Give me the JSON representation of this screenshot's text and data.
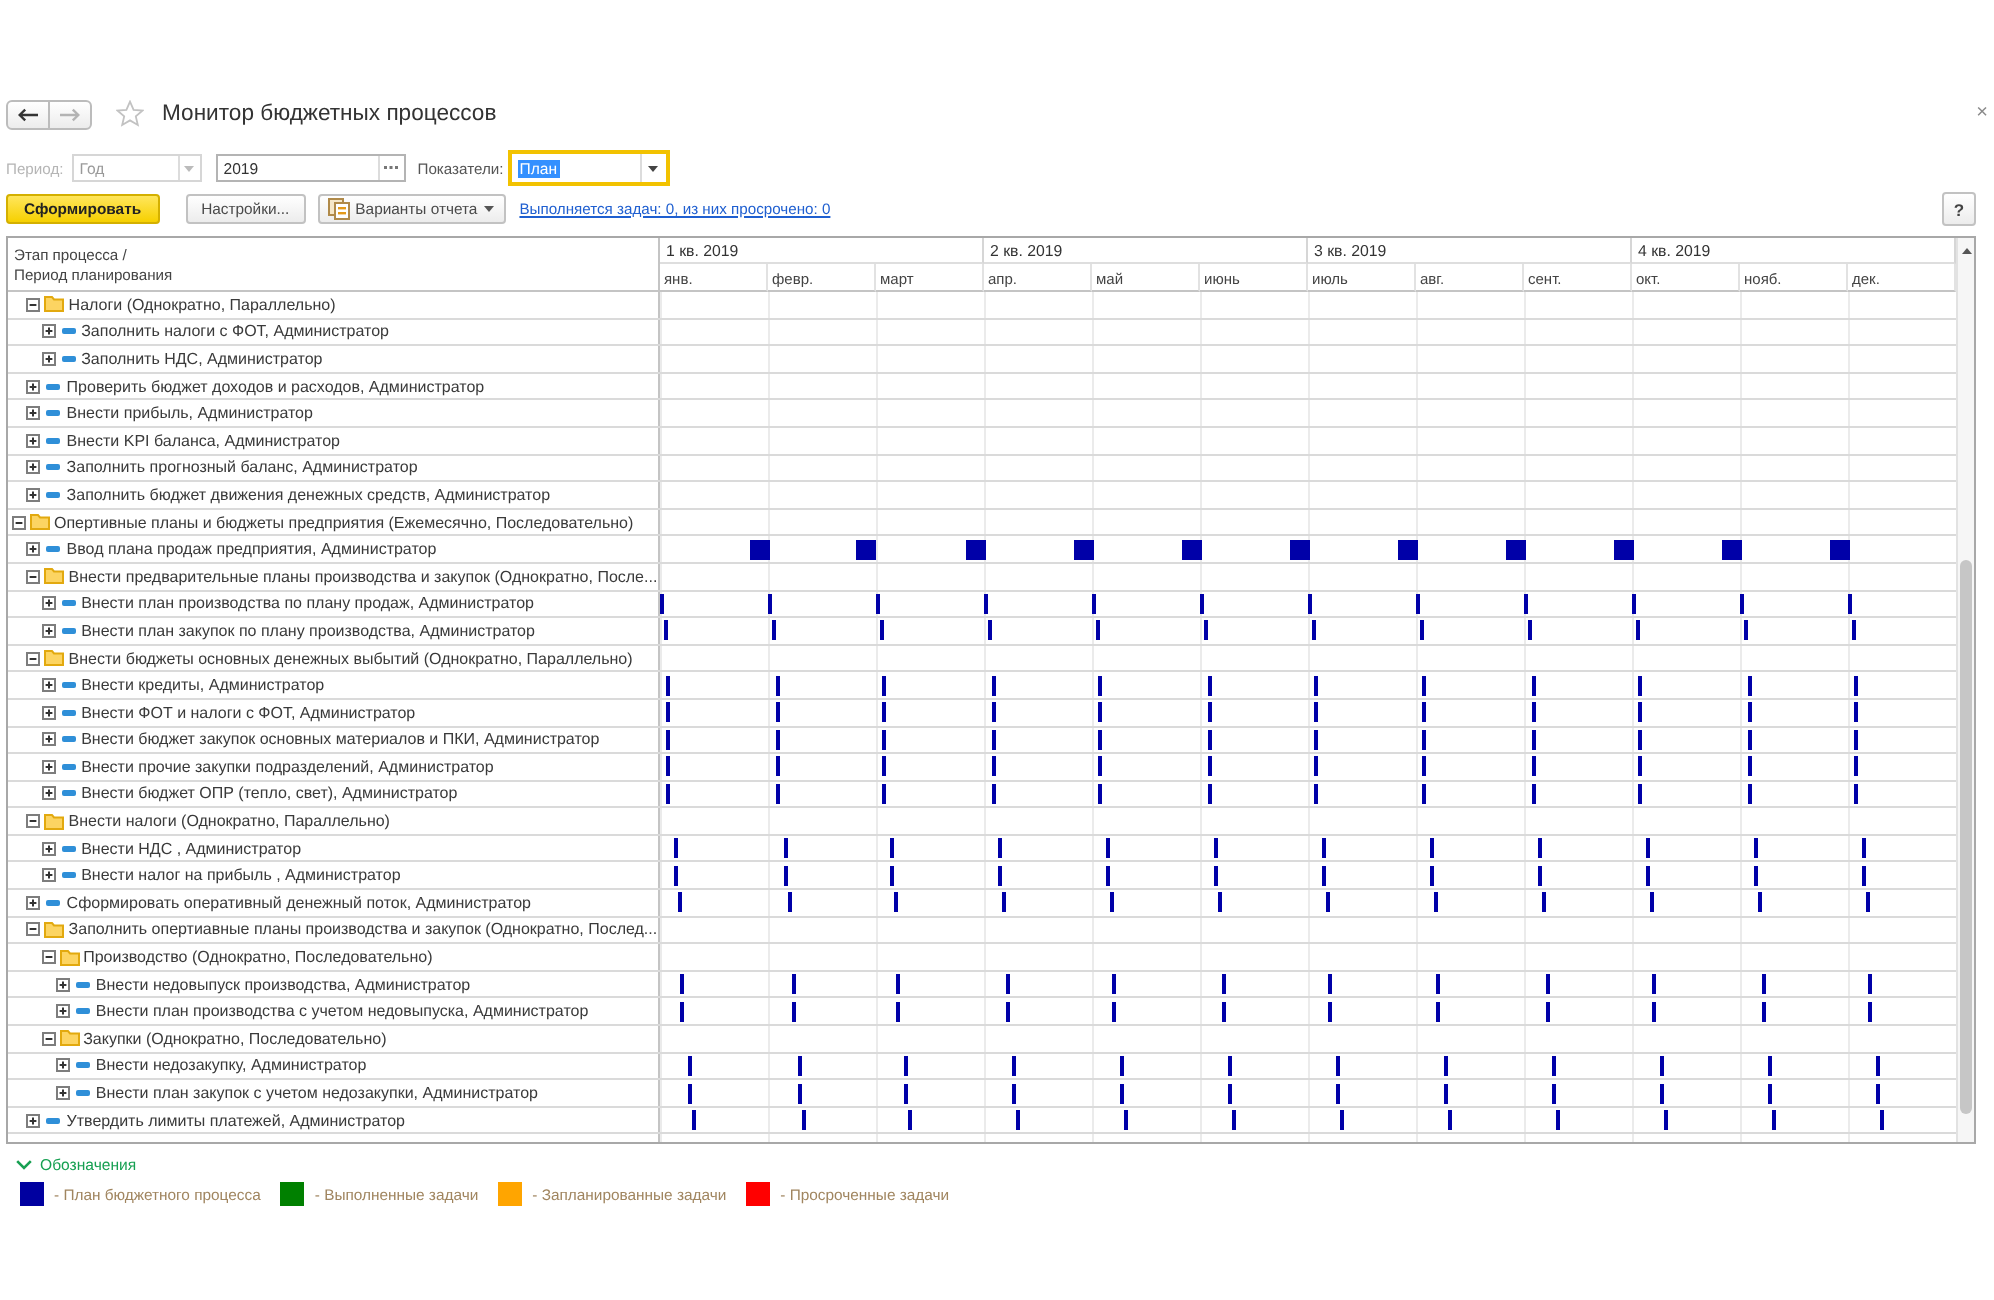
{
  "window": {
    "title": "Монитор бюджетных процессов",
    "favorite": false,
    "close": "×",
    "navigation": [
      {
        "kind": "back",
        "disabled": false
      },
      {
        "kind": "forward",
        "disabled": true
      }
    ]
  },
  "filters": {
    "period": {
      "label": "Период:",
      "value": "Год",
      "disabled": true
    },
    "year": {
      "value": "2019"
    },
    "indicators": {
      "label": "Показатели:",
      "value": "План",
      "focused": true
    }
  },
  "toolbar": {
    "buttons": [
      {
        "label": "Сформировать",
        "kind": "primary"
      },
      {
        "label": "Настройки...",
        "kind": "plain"
      },
      {
        "label": "Варианты отчета",
        "kind": "menu"
      }
    ],
    "link": "Выполняется задач: 0, из них просрочено: 0",
    "help": "?"
  },
  "table": {
    "header": "Этап процесса /\nПериод планирования",
    "quarters": [
      "1 кв. 2019",
      "2 кв. 2019",
      "3 кв. 2019",
      "4 кв. 2019"
    ],
    "months": [
      "янв.",
      "февр.",
      "март",
      "апр.",
      "май",
      "июнь",
      "июль",
      "авг.",
      "сент.",
      "окт.",
      "нояб.",
      "дек."
    ],
    "rows": [
      {
        "children": [
          {
            "label": "Налоги (Однократно, Параллельно)",
            "kind": "folder",
            "expanded": true,
            "children": [
              {
                "label": "Заполнить налоги с ФОТ, Администратор",
                "kind": "task",
                "expanded": false
              },
              {
                "label": "Заполнить НДС, Администратор",
                "kind": "task",
                "expanded": false
              }
            ]
          },
          {
            "label": "Проверить бюджет доходов и расходов, Администратор",
            "kind": "task",
            "expanded": false
          },
          {
            "label": "Внести прибыль, Администратор",
            "kind": "task",
            "expanded": false
          },
          {
            "label": "Внести KPI баланса, Администратор",
            "kind": "task",
            "expanded": false
          },
          {
            "label": "Заполнить прогнозный баланс, Администратор",
            "kind": "task",
            "expanded": false
          },
          {
            "label": "Заполнить бюджет движения денежных средств, Администратор",
            "kind": "task",
            "expanded": false
          }
        ]
      },
      {
        "label": "Опертивные планы и бюджеты предприятия (Ежемесячно, Последовательно)",
        "kind": "folder",
        "expanded": true,
        "children": [
          {
            "label": "Ввод плана продаж предприятия, Администратор",
            "kind": "task",
            "expanded": false
          },
          {
            "label": "Внести предварительные планы производства и закупок (Однократно, После...",
            "kind": "folder",
            "expanded": true,
            "children": [
              {
                "label": "Внести план производства по плану продаж, Администратор",
                "kind": "task",
                "expanded": false
              },
              {
                "label": "Внести план закупок по плану производства, Администратор",
                "kind": "task",
                "expanded": false
              }
            ]
          },
          {
            "label": "Внести бюджеты основных денежных выбытий (Однократно, Параллельно)",
            "kind": "folder",
            "expanded": true,
            "children": [
              {
                "label": "Внести кредиты, Администратор",
                "kind": "task",
                "expanded": false
              },
              {
                "label": "Внести ФОТ и налоги с ФОТ, Администратор",
                "kind": "task",
                "expanded": false
              },
              {
                "label": "Внести бюджет закупок основных материалов и ПКИ, Администратор",
                "kind": "task",
                "expanded": false
              },
              {
                "label": "Внести прочие закупки подразделений, Администратор",
                "kind": "task",
                "expanded": false
              },
              {
                "label": "Внести бюджет ОПР (тепло, свет), Администратор",
                "kind": "task",
                "expanded": false
              }
            ]
          },
          {
            "label": "Внести налоги (Однократно, Параллельно)",
            "kind": "folder",
            "expanded": true,
            "children": [
              {
                "label": "Внести НДС , Администратор",
                "kind": "task",
                "expanded": false
              },
              {
                "label": "Внести налог на прибыль , Администратор",
                "kind": "task",
                "expanded": false
              }
            ]
          },
          {
            "label": "Сформировать оперативный денежный поток, Администратор",
            "kind": "task",
            "expanded": false
          },
          {
            "label": "Заполнить опертиавные планы производства и закупок (Однократно, Послед...",
            "kind": "folder",
            "expanded": true,
            "children": [
              {
                "label": "Производство (Однократно, Последовательно)",
                "kind": "folder",
                "expanded": true,
                "children": [
                  {
                    "label": "Внести недовыпуск производства, Администратор",
                    "kind": "task",
                    "expanded": false
                  },
                  {
                    "label": "Внести план производства с учетом недовыпуска, Администратор",
                    "kind": "task",
                    "expanded": false
                  }
                ]
              },
              {
                "label": "Закупки (Однократно, Последовательно)",
                "kind": "folder",
                "expanded": true,
                "children": [
                  {
                    "label": "Внести недозакупку, Администратор",
                    "kind": "task",
                    "expanded": false
                  },
                  {
                    "label": "Внести план закупок с учетом недозакупки, Администратор",
                    "kind": "task",
                    "expanded": false
                  }
                ]
              }
            ]
          },
          {
            "label": "Утвердить лимиты платежей, Администратор",
            "kind": "task",
            "expanded": false
          }
        ]
      }
    ]
  },
  "legend": {
    "title": "Обозначения",
    "expanded": true,
    "items": [
      {
        "label": "- План бюджетного процесса",
        "color": "#0000a0"
      },
      {
        "label": "- Выполненные задачи",
        "color": "#008000"
      },
      {
        "label": "- Запланированные задачи",
        "color": "#ffa500"
      },
      {
        "label": "- Просроченные задачи",
        "color": "#ff0000"
      }
    ]
  }
}
